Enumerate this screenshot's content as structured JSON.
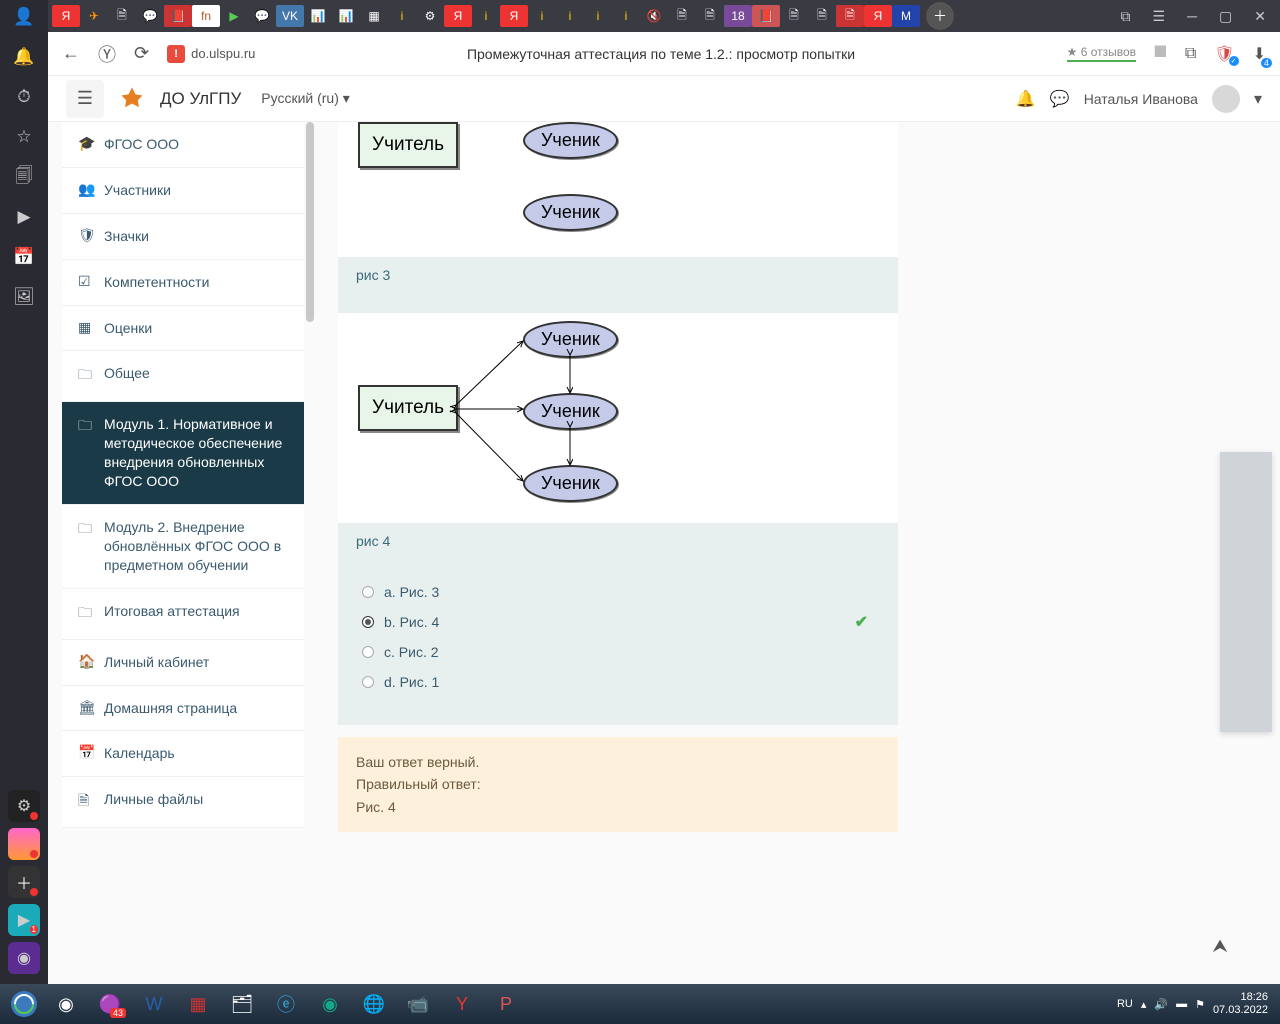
{
  "os_left": [
    "👤",
    "🔔",
    "⏱",
    "☆",
    "🗐",
    "▶",
    "📅",
    "🖼"
  ],
  "tabs": [
    "Я",
    "✈",
    "🗎",
    "💬",
    "📕",
    "fn",
    "▶",
    "💬",
    "VK",
    "📊",
    "📊",
    "▦",
    "i",
    "⚙",
    "Я",
    "i",
    "Я",
    "i",
    "i",
    "i",
    "i",
    "🔇",
    "🗎",
    "🗎",
    "18",
    "📕",
    "🗎",
    "🗎",
    "🗎",
    "Я",
    "M"
  ],
  "toolbar": {
    "url": "do.ulspu.ru",
    "title": "Промежуточная аттестация по теме 1.2.: просмотр попытки",
    "reviews": "★ 6 отзывов"
  },
  "header": {
    "site": "ДО УлГПУ",
    "lang": "Русский (ru) ▾",
    "user": "Наталья Иванова"
  },
  "sidebar": [
    {
      "icon": "🎓",
      "label": "ФГОС ООО"
    },
    {
      "icon": "👥",
      "label": "Участники"
    },
    {
      "icon": "🛡",
      "label": "Значки"
    },
    {
      "icon": "☑",
      "label": "Компетентности"
    },
    {
      "icon": "▦",
      "label": "Оценки"
    },
    {
      "icon": "🗀",
      "label": "Общее"
    },
    {
      "icon": "🗀",
      "label": "Модуль 1. Нормативное и методическое обеспечение внедрения обновленных ФГОС ООО",
      "active": true
    },
    {
      "icon": "🗀",
      "label": "Модуль 2. Внедрение обновлённых ФГОС ООО в предметном обучении"
    },
    {
      "icon": "🗀",
      "label": "Итоговая аттестация"
    },
    {
      "icon": "🏠",
      "label": "Личный кабинет"
    },
    {
      "icon": "🏛",
      "label": "Домашняя страница"
    },
    {
      "icon": "📅",
      "label": "Календарь"
    },
    {
      "icon": "🗎",
      "label": "Личные файлы"
    }
  ],
  "figs": {
    "teacher": "Учитель",
    "student": "Ученик",
    "cap3": "рис 3",
    "cap4": "рис 4"
  },
  "answers": [
    {
      "t": "a. Рис. 3",
      "sel": false
    },
    {
      "t": "b. Рис. 4",
      "sel": true,
      "correct": true
    },
    {
      "t": "c. Рис. 2",
      "sel": false
    },
    {
      "t": "d. Рис. 1",
      "sel": false
    }
  ],
  "feedback": {
    "l1": "Ваш ответ верный.",
    "l2": "Правильный ответ:",
    "l3": "Рис. 4"
  },
  "tray": {
    "lang": "RU",
    "time": "18:26",
    "date": "07.03.2022"
  },
  "taskbar_badge": "43",
  "download_badge": "4"
}
